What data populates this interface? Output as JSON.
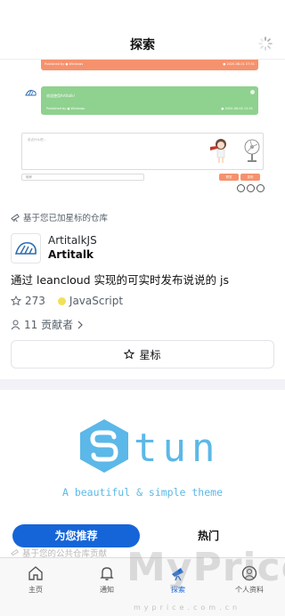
{
  "header": {
    "title": "探索"
  },
  "preview": {
    "orange_meta_left": "Published by ● Windows",
    "orange_meta_right": "● 2020-06-01 07:51",
    "green_body": "欢迎使用Artitalk!",
    "green_meta_left": "Published by ● Windows",
    "green_meta_right": "● 2020-06-04 12:51",
    "editor_placeholder": "说点什么吧…",
    "name_placeholder": "昵称",
    "btn_preview": "预览",
    "btn_publish": "发布"
  },
  "starred": {
    "section_label": "基于您已加星标的仓库",
    "owner": "ArtitalkJS",
    "name": "Artitalk",
    "description": "通过 leancloud 实现的可实时发布说说的 js",
    "stars": "273",
    "language": "JavaScript",
    "language_color": "#f1e05a",
    "contributors": "11 贡献者",
    "star_button": "星标"
  },
  "banner": {
    "word": "tun",
    "tagline": "A beautiful & simple theme",
    "accent": "#5bb8e8"
  },
  "feed_toggle": {
    "recommend": "为您推荐",
    "hot": "热门",
    "accent": "#1565d8"
  },
  "peek_label": "基于您的公共仓库贡献",
  "tabs": [
    {
      "label": "主页",
      "icon": "home-icon"
    },
    {
      "label": "通知",
      "icon": "bell-icon"
    },
    {
      "label": "探索",
      "icon": "telescope-icon"
    },
    {
      "label": "个人资料",
      "icon": "person-icon"
    }
  ],
  "watermark": {
    "text": "MyPrice",
    "url": "myprice.com.cn"
  }
}
